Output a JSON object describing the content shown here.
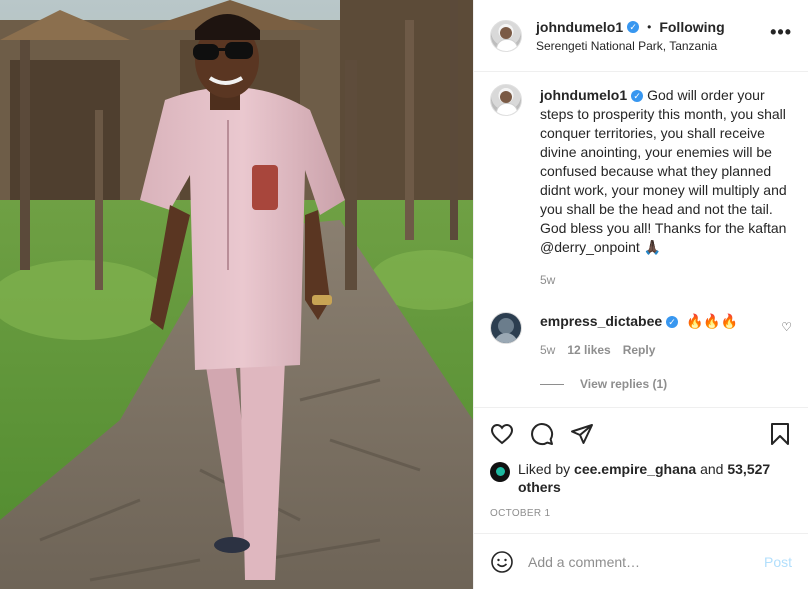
{
  "post": {
    "author": {
      "username": "johndumelo1",
      "verified": true,
      "follow_status": "Following",
      "location": "Serengeti National Park, Tanzania",
      "avatar_icon": "user-avatar"
    },
    "photo": {
      "description_icon": "post-photo"
    },
    "caption": {
      "username": "johndumelo1",
      "text": "God will order your steps to prosperity this month, you shall conquer territories, you shall receive divine anointing, your enemies will be confused because what they planned didnt work, your money will multiply and you shall be the head and not the tail. God bless you all! Thanks for the kaftan @derry_onpoint 🙏🏿",
      "age": "5w"
    },
    "comments": [
      {
        "username": "empress_dictabee",
        "verified": true,
        "text": "🔥🔥🔥",
        "age": "5w",
        "likes": "12 likes",
        "reply_label": "Reply",
        "view_replies": "View replies (1)"
      }
    ],
    "liked_by": {
      "prefix": "Liked by",
      "user": "cee.empire_ghana",
      "connector": "and",
      "others": "53,527 others"
    },
    "date": "OCTOBER 1",
    "add_comment": {
      "placeholder": "Add a comment…",
      "post_label": "Post"
    }
  },
  "colors": {
    "verified_blue": "#3897f0",
    "muted_text": "#8e8e8e",
    "post_button_disabled": "#b2dffc",
    "divider": "#efefef"
  }
}
